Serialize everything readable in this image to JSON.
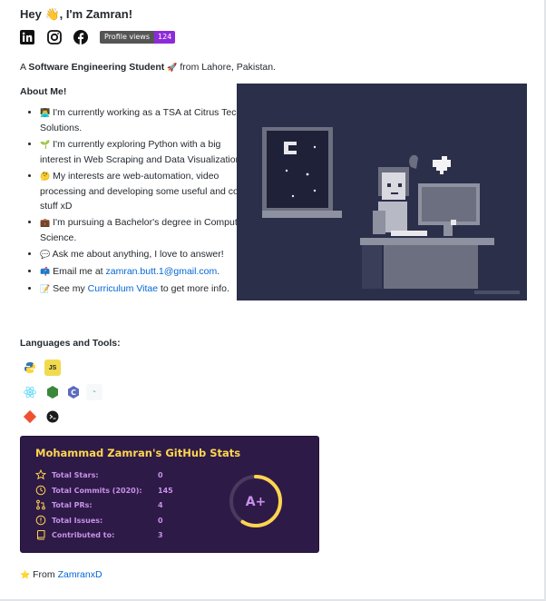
{
  "header": {
    "title": "Hey 👋, I'm Zamran!",
    "badge_label": "Profile views",
    "badge_value": "124"
  },
  "social": [
    "linkedin-icon",
    "instagram-icon",
    "facebook-icon"
  ],
  "intro": {
    "prefix": "A ",
    "bold": "Software Engineering Student",
    "emoji": "🚀",
    "suffix": " from Lahore, Pakistan."
  },
  "about": {
    "heading": "About Me!",
    "items": [
      {
        "emoji": "👨‍💻",
        "text": "I'm currently working as a TSA at Citrus Tech Solutions."
      },
      {
        "emoji": "🌱",
        "text": "I'm currently exploring Python with a big interest in Web Scraping and Data Visualization."
      },
      {
        "emoji": "🤔",
        "text": "My interests are web-automation, video processing and developing some useful and cool stuff xD"
      },
      {
        "emoji": "💼",
        "text": "I'm pursuing a Bachelor's degree in Computer Science."
      },
      {
        "emoji": "💬",
        "text": "Ask me about anything, I love to answer!"
      }
    ],
    "email_emoji": "📫",
    "email_prefix": "Email me at ",
    "email": "zamran.butt.1@gmail.com",
    "email_suffix": ".",
    "cv_emoji": "📝",
    "cv_prefix": "See my ",
    "cv_link": "Curriculum Vitae",
    "cv_suffix": " to get more info."
  },
  "tools": {
    "heading": "Languages and Tools:",
    "items": [
      "python",
      "javascript",
      "react",
      "nodejs",
      "c",
      "mysql",
      "git",
      "bash"
    ]
  },
  "stats": {
    "title": "Mohammad Zamran's GitHub Stats",
    "rows": [
      {
        "label": "Total Stars:",
        "value": "0",
        "icon": "star-icon"
      },
      {
        "label": "Total Commits (2020):",
        "value": "145",
        "icon": "clock-icon"
      },
      {
        "label": "Total PRs:",
        "value": "4",
        "icon": "pull-request-icon"
      },
      {
        "label": "Total Issues:",
        "value": "0",
        "icon": "issue-icon"
      },
      {
        "label": "Contributed to:",
        "value": "3",
        "icon": "repo-icon"
      }
    ],
    "grade": "A+",
    "colors": {
      "bg": "#2e1a47",
      "title": "#ffd54f",
      "text": "#c792ea",
      "ring": "#ffd54f"
    }
  },
  "footer": {
    "emoji": "⭐",
    "prefix": " From ",
    "link": "ZamranxD"
  }
}
